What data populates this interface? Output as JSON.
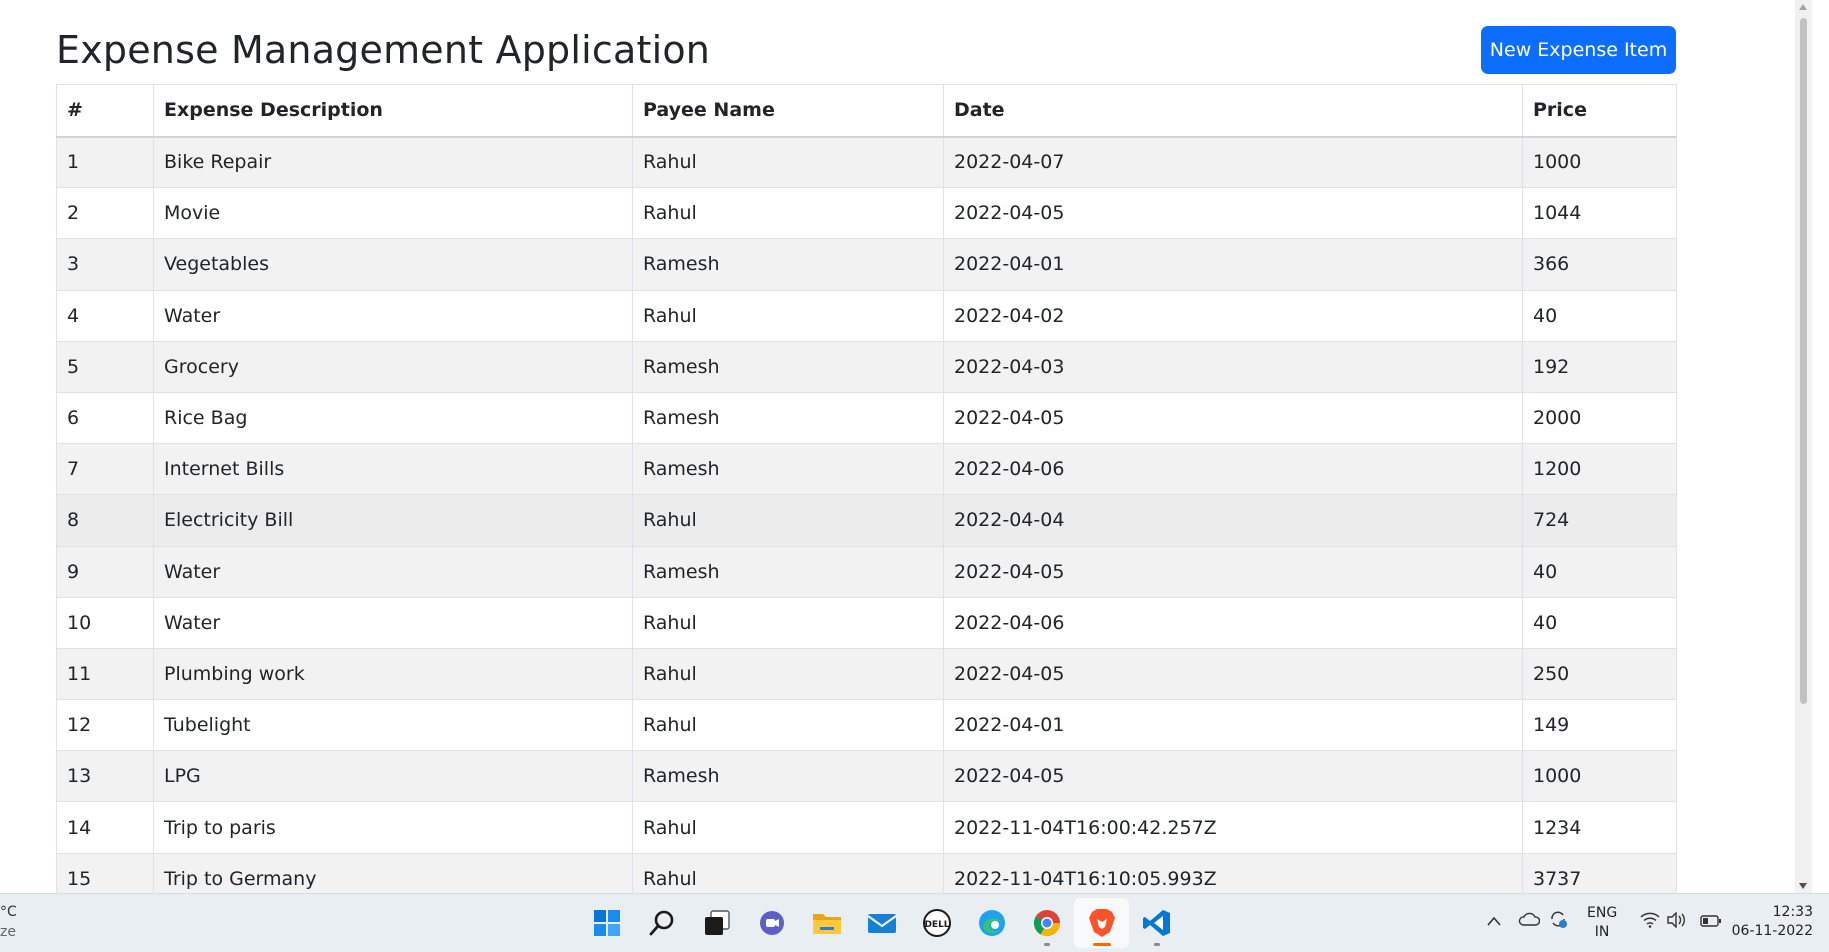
{
  "app": {
    "title": "Expense Management Application",
    "new_button_label": "New Expense Item"
  },
  "table": {
    "headers": [
      "#",
      "Expense Description",
      "Payee Name",
      "Date",
      "Price"
    ],
    "rows": [
      [
        "1",
        "Bike Repair",
        "Rahul",
        "2022-04-07",
        "1000"
      ],
      [
        "2",
        "Movie",
        "Rahul",
        "2022-04-05",
        "1044"
      ],
      [
        "3",
        "Vegetables",
        "Ramesh",
        "2022-04-01",
        "366"
      ],
      [
        "4",
        "Water",
        "Rahul",
        "2022-04-02",
        "40"
      ],
      [
        "5",
        "Grocery",
        "Ramesh",
        "2022-04-03",
        "192"
      ],
      [
        "6",
        "Rice Bag",
        "Ramesh",
        "2022-04-05",
        "2000"
      ],
      [
        "7",
        "Internet Bills",
        "Ramesh",
        "2022-04-06",
        "1200"
      ],
      [
        "8",
        "Electricity Bill",
        "Rahul",
        "2022-04-04",
        "724"
      ],
      [
        "9",
        "Water",
        "Ramesh",
        "2022-04-05",
        "40"
      ],
      [
        "10",
        "Water",
        "Rahul",
        "2022-04-06",
        "40"
      ],
      [
        "11",
        "Plumbing work",
        "Rahul",
        "2022-04-05",
        "250"
      ],
      [
        "12",
        "Tubelight",
        "Rahul",
        "2022-04-01",
        "149"
      ],
      [
        "13",
        "LPG",
        "Ramesh",
        "2022-04-05",
        "1000"
      ],
      [
        "14",
        "Trip to paris",
        "Rahul",
        "2022-11-04T16:00:42.257Z",
        "1234"
      ],
      [
        "15",
        "Trip to Germany",
        "Rahul",
        "2022-11-04T16:10:05.993Z",
        "3737"
      ]
    ]
  },
  "taskbar": {
    "weather_line1": "°C",
    "weather_line2": "ze",
    "apps": [
      "windows-start",
      "search",
      "task-view",
      "teams-chat",
      "file-explorer",
      "mail",
      "dell",
      "edge",
      "chrome",
      "brave",
      "vscode"
    ],
    "language_line1": "ENG",
    "language_line2": "IN",
    "time": "12:33",
    "date": "06-11-2022"
  },
  "colors": {
    "accent": "#0d6efd",
    "stripe": "#f2f2f2",
    "border": "#dee2e6"
  }
}
